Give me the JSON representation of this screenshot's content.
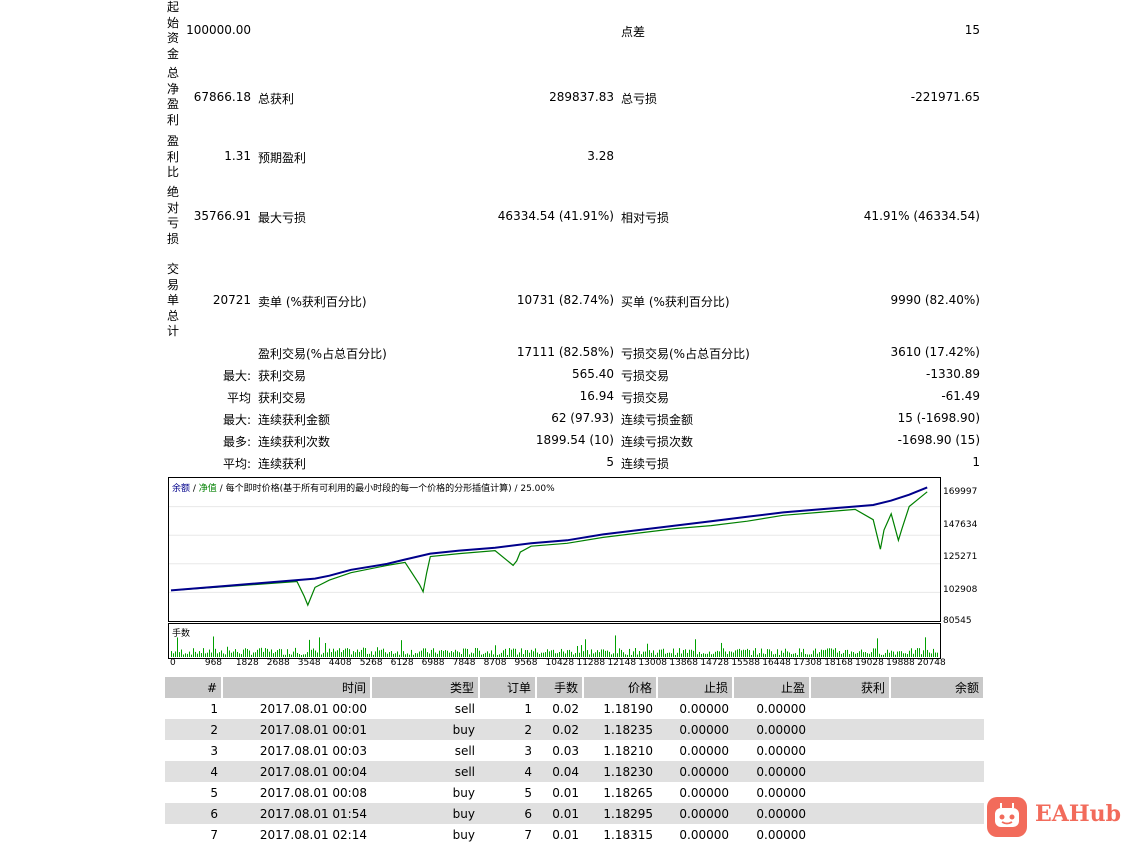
{
  "summary": {
    "initial_deposit": {
      "label": "起始资金",
      "value": "100000.00"
    },
    "spread": {
      "label": "点差",
      "value": "15"
    },
    "total_net_profit": {
      "label": "总净盈利",
      "value": "67866.18"
    },
    "gross_profit": {
      "label": "总获利",
      "value": "289837.83"
    },
    "gross_loss": {
      "label": "总亏损",
      "value": "-221971.65"
    },
    "profit_factor": {
      "label": "盈利比",
      "value": "1.31"
    },
    "expected_payoff": {
      "label": "预期盈利",
      "value": "3.28"
    },
    "absolute_drawdown": {
      "label": "绝对亏损",
      "value": "35766.91"
    },
    "maximal_drawdown": {
      "label": "最大亏损",
      "value": "46334.54 (41.91%)"
    },
    "relative_drawdown": {
      "label": "相对亏损",
      "value": "41.91% (46334.54)"
    },
    "total_trades": {
      "label": "交易单总计",
      "value": "20721"
    },
    "short_positions": {
      "label": "卖单 (%获利百分比)",
      "value": "10731 (82.74%)"
    },
    "long_positions": {
      "label": "买单 (%获利百分比)",
      "value": "9990 (82.40%)"
    },
    "profit_trades": {
      "label": "盈利交易(%占总百分比)",
      "value": "17111 (82.58%)"
    },
    "loss_trades": {
      "label": "亏损交易(%占总百分比)",
      "value": "3610 (17.42%)"
    },
    "largest": {
      "prefix": "最大:",
      "profit_label": "获利交易",
      "profit_value": "565.40",
      "loss_label": "亏损交易",
      "loss_value": "-1330.89"
    },
    "average": {
      "prefix": "平均",
      "profit_label": "获利交易",
      "profit_value": "16.94",
      "loss_label": "亏损交易",
      "loss_value": "-61.49"
    },
    "max_consecutive": {
      "prefix": "最大:",
      "profit_label": "连续获利金额",
      "profit_value": "62 (97.93)",
      "loss_label": "连续亏损金额",
      "loss_value": "15 (-1698.90)"
    },
    "maximal_consecutive": {
      "prefix": "最多:",
      "profit_label": "连续获利次数",
      "profit_value": "1899.54 (10)",
      "loss_label": "连续亏损次数",
      "loss_value": "-1698.90 (15)"
    },
    "average_consecutive": {
      "prefix": "平均:",
      "profit_label": "连续获利",
      "profit_value": "5",
      "loss_label": "连续亏损",
      "loss_value": "1"
    }
  },
  "chart_data": {
    "type": "line",
    "legend": [
      "余额",
      "净值"
    ],
    "legend_text": "余额 / 净值 / 每个即时价格(基于所有可利用的最小时段的每一个价格的分形插值计算) / 25.00%",
    "legend_parts": {
      "sep": " / ",
      "rest": "每个即时价格(基于所有可利用的最小时段的每一个价格的分形插值计算) / 25.00%"
    },
    "y_ticks": [
      "169997",
      "147634",
      "125271",
      "102908",
      "80545"
    ],
    "ylim": [
      80545,
      175000
    ],
    "x_ticks": [
      "0",
      "968",
      "1828",
      "2688",
      "3548",
      "4408",
      "5268",
      "6128",
      "6988",
      "7848",
      "8708",
      "9568",
      "10428",
      "11288",
      "12148",
      "13008",
      "13868",
      "14728",
      "15588",
      "16448",
      "17308",
      "18168",
      "19028",
      "19888",
      "20748"
    ],
    "xlim": [
      0,
      21300
    ],
    "volume_label": "手数",
    "series": [
      {
        "name": "余额",
        "color": "#00008b",
        "x": [
          0,
          1500,
          3500,
          4000,
          4400,
          5000,
          6000,
          6500,
          7200,
          8000,
          9000,
          10000,
          11000,
          12000,
          13000,
          14000,
          15000,
          16000,
          17000,
          18000,
          19000,
          19500,
          20000,
          20500,
          20800,
          21000
        ],
        "values": [
          100000,
          103000,
          107000,
          108000,
          110000,
          114000,
          118000,
          121000,
          125000,
          127000,
          129000,
          132000,
          134000,
          138000,
          141000,
          144000,
          147000,
          150000,
          153000,
          155000,
          157000,
          158000,
          161000,
          165000,
          168000,
          170000
        ]
      },
      {
        "name": "净值",
        "color": "#008000",
        "x": [
          0,
          1500,
          3500,
          3700,
          3800,
          4000,
          4400,
          5000,
          6000,
          6500,
          6900,
          7000,
          7100,
          7200,
          8000,
          9000,
          9500,
          9600,
          9700,
          10000,
          11000,
          12000,
          13000,
          14000,
          15000,
          16000,
          17000,
          18000,
          19000,
          19500,
          19700,
          19800,
          20000,
          20200,
          20300,
          20500,
          20800,
          21000
        ],
        "values": [
          100000,
          102500,
          106000,
          96000,
          90000,
          102000,
          107000,
          112000,
          117000,
          119000,
          104000,
          99000,
          112000,
          123000,
          125000,
          127000,
          117000,
          120000,
          126000,
          130000,
          132000,
          136000,
          139000,
          142000,
          144000,
          147000,
          151000,
          153000,
          155000,
          148000,
          128000,
          141000,
          152000,
          134000,
          142000,
          157000,
          163000,
          167000
        ]
      }
    ]
  },
  "trades_table": {
    "headers": [
      "#",
      "时间",
      "类型",
      "订单",
      "手数",
      "价格",
      "止损",
      "止盈",
      "获利",
      "余额"
    ],
    "rows": [
      [
        "1",
        "2017.08.01 00:00",
        "sell",
        "1",
        "0.02",
        "1.18190",
        "0.00000",
        "0.00000",
        "",
        ""
      ],
      [
        "2",
        "2017.08.01 00:01",
        "buy",
        "2",
        "0.02",
        "1.18235",
        "0.00000",
        "0.00000",
        "",
        ""
      ],
      [
        "3",
        "2017.08.01 00:03",
        "sell",
        "3",
        "0.03",
        "1.18210",
        "0.00000",
        "0.00000",
        "",
        ""
      ],
      [
        "4",
        "2017.08.01 00:04",
        "sell",
        "4",
        "0.04",
        "1.18230",
        "0.00000",
        "0.00000",
        "",
        ""
      ],
      [
        "5",
        "2017.08.01 00:08",
        "buy",
        "5",
        "0.01",
        "1.18265",
        "0.00000",
        "0.00000",
        "",
        ""
      ],
      [
        "6",
        "2017.08.01 01:54",
        "buy",
        "6",
        "0.01",
        "1.18295",
        "0.00000",
        "0.00000",
        "",
        ""
      ],
      [
        "7",
        "2017.08.01 02:14",
        "buy",
        "7",
        "0.01",
        "1.18315",
        "0.00000",
        "0.00000",
        "",
        ""
      ]
    ]
  },
  "logo": {
    "text": "EAHub",
    "icon": "robot-face-icon",
    "color": "#f26b5b"
  }
}
